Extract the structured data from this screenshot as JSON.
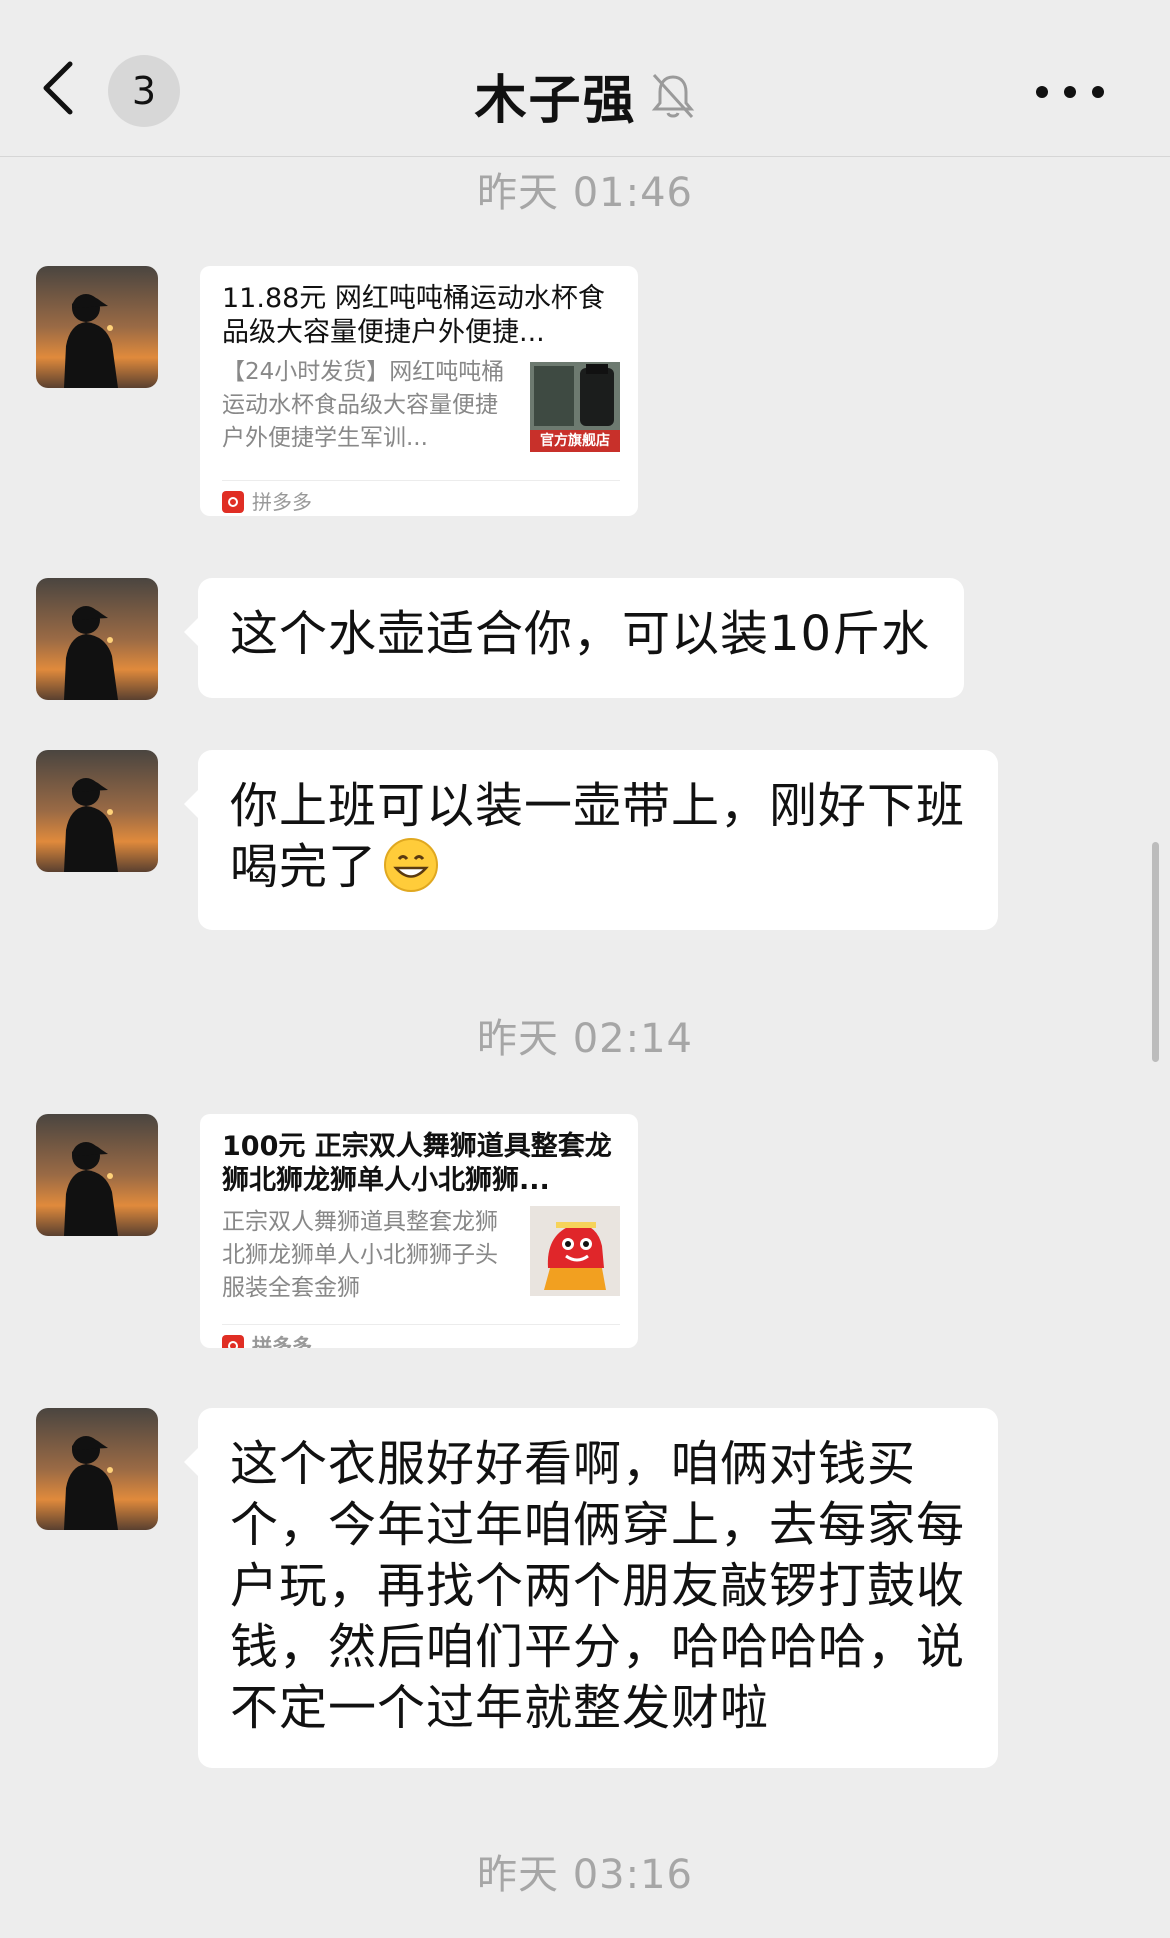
{
  "header": {
    "back_label": "back",
    "unread_count": "3",
    "title": "木子强",
    "mute_icon": "bell-off-icon",
    "more_icon": "more-icon"
  },
  "messages": {
    "time1": "昨天 01:46",
    "card1": {
      "title": "11.88元 网红吨吨桶运动水杯食品级大容量便捷户外便捷...",
      "desc": "【24小时发货】网红吨吨桶运动水杯食品级大容量便捷户外便捷学生军训...",
      "thumb_badge": "官方旗舰店",
      "source": "拼多多"
    },
    "msg1": "这个水壶适合你，可以装10斤水",
    "msg2": "你上班可以装一壶带上，刚好下班喝完了",
    "time2": "昨天 02:14",
    "card2": {
      "title": "100元 正宗双人舞狮道具整套龙狮北狮龙狮单人小北狮狮...",
      "desc": "正宗双人舞狮道具整套龙狮北狮龙狮单人小北狮狮子头服装全套金狮",
      "source": "拼多多"
    },
    "msg3": "这个衣服好好看啊，咱俩对钱买个，今年过年咱俩穿上，去每家每户玩，再找个两个朋友敲锣打鼓收钱，然后咱们平分，哈哈哈哈，说不定一个过年就整发财啦",
    "time3": "昨天 03:16"
  },
  "colors": {
    "background": "#ededed",
    "bubble": "#ffffff",
    "timestamp": "#a6a6a6",
    "pdd_red": "#e02e24"
  }
}
